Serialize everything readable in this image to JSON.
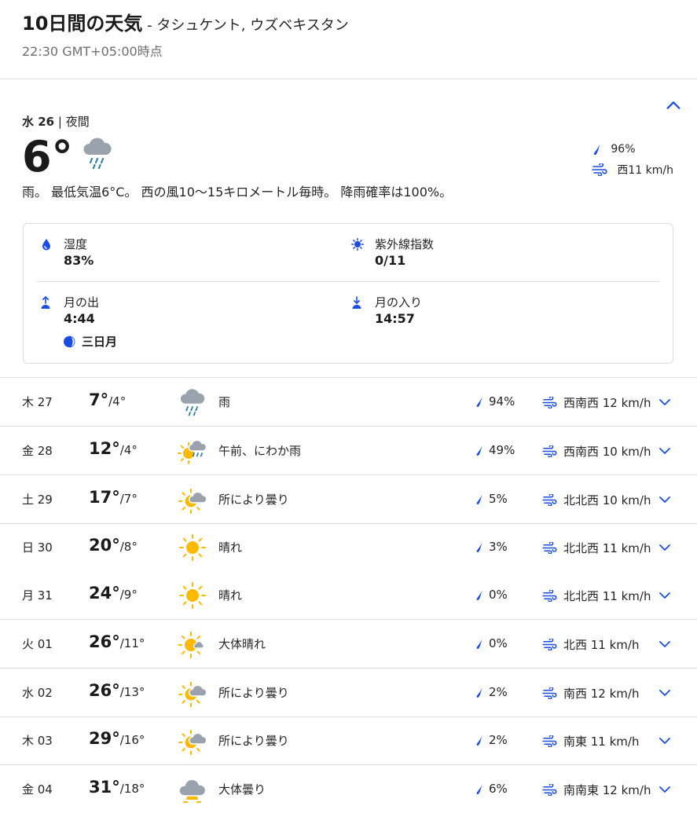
{
  "header": {
    "title": "10日間の天気",
    "location": " - タシュケント, ウズベキスタン",
    "timestamp": "22:30 GMT+05:00時点"
  },
  "current": {
    "day_name": "水 26",
    "separator": " | ",
    "period": "夜間",
    "temperature": "6°",
    "icon": "rain-cloud-icon",
    "precip": "96%",
    "wind": "西11 km/h",
    "narrative": "雨。 最低気温6°C。 西の風10～15キロメートル毎時。 降雨確率は100%。",
    "details": {
      "humidity_label": "湿度",
      "humidity_value": "83%",
      "uv_label": "紫外線指数",
      "uv_value": "0/11",
      "moonrise_label": "月の出",
      "moonrise_value": "4:44",
      "moonset_label": "月の入り",
      "moonset_value": "14:57",
      "moon_phase": "三日月"
    }
  },
  "colors": {
    "accent": "#1b4de4",
    "sun": "#fcb900",
    "cloud": "#9aa3ad",
    "rain": "#3a7fa8",
    "divider": "#dedede"
  },
  "days": [
    {
      "date": "木 27",
      "high": "7°",
      "low": "/4°",
      "icon": "rain-cloud-icon",
      "condition": "雨",
      "precip": "94%",
      "wind": "西南西 12 km/h"
    },
    {
      "date": "金 28",
      "high": "12°",
      "low": "/4°",
      "icon": "sun-showers-icon",
      "condition": "午前、にわか雨",
      "precip": "49%",
      "wind": "西南西 10 km/h"
    },
    {
      "date": "土 29",
      "high": "17°",
      "low": "/7°",
      "icon": "partly-cloudy-icon",
      "condition": "所により曇り",
      "precip": "5%",
      "wind": "北北西 10 km/h"
    },
    {
      "date": "日 30",
      "high": "20°",
      "low": "/8°",
      "icon": "sun-icon",
      "condition": "晴れ",
      "precip": "3%",
      "wind": "北北西 11 km/h"
    },
    {
      "date": "月 31",
      "high": "24°",
      "low": "/9°",
      "icon": "sun-icon",
      "condition": "晴れ",
      "precip": "0%",
      "wind": "北北西 11 km/h"
    },
    {
      "date": "火 01",
      "high": "26°",
      "low": "/11°",
      "icon": "mostly-sunny-icon",
      "condition": "大体晴れ",
      "precip": "0%",
      "wind": "北西 11 km/h"
    },
    {
      "date": "水 02",
      "high": "26°",
      "low": "/13°",
      "icon": "partly-cloudy-icon",
      "condition": "所により曇り",
      "precip": "2%",
      "wind": "南西 12 km/h"
    },
    {
      "date": "木 03",
      "high": "29°",
      "low": "/16°",
      "icon": "partly-cloudy-icon",
      "condition": "所により曇り",
      "precip": "2%",
      "wind": "南東 11 km/h"
    },
    {
      "date": "金 04",
      "high": "31°",
      "low": "/18°",
      "icon": "mostly-cloudy-icon",
      "condition": "大体曇り",
      "precip": "6%",
      "wind": "南南東 12 km/h"
    }
  ]
}
